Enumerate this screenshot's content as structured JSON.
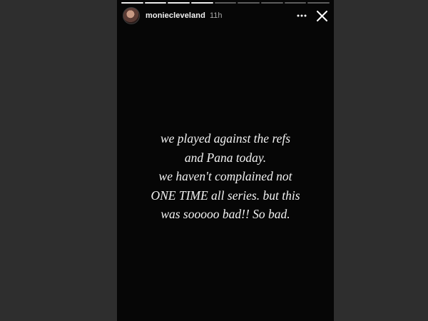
{
  "story": {
    "username": "moniecleveland",
    "time_ago": "11h",
    "progress": {
      "segments_total": 9,
      "segments_viewed": 4
    },
    "text_lines": [
      "we played against the refs",
      "and Pana today.",
      "we haven't complained not",
      "ONE TIME all series. but this",
      "was sooooo bad!! So bad."
    ]
  },
  "icons": {
    "more": "more-horizontal-icon",
    "close": "close-icon"
  },
  "colors": {
    "story_background": "#060606",
    "page_background": "#2e2e2e",
    "text": "#f2f2f2"
  }
}
